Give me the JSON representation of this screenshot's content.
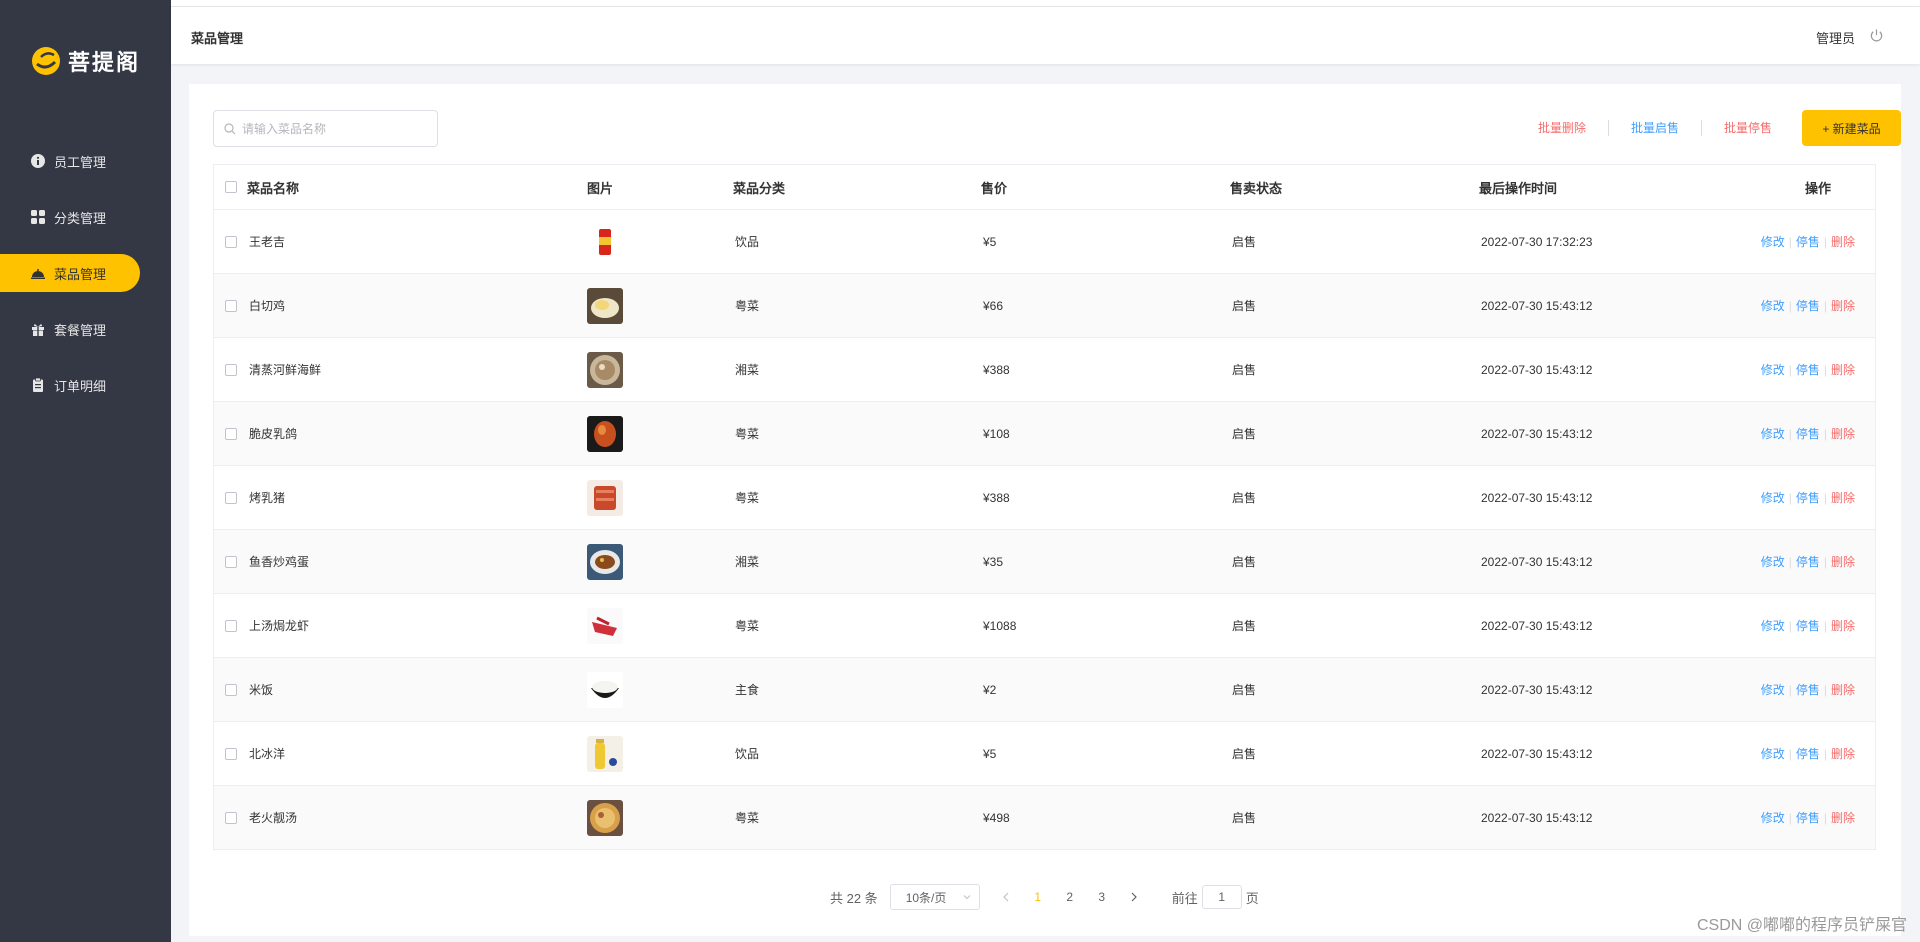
{
  "brand": {
    "name": "菩提阁",
    "accent": "#ffc200",
    "sidebar_bg": "#343744"
  },
  "sidebar": {
    "items": [
      {
        "label": "员工管理",
        "icon": "info-icon"
      },
      {
        "label": "分类管理",
        "icon": "grid-icon"
      },
      {
        "label": "菜品管理",
        "icon": "dish-cover-icon",
        "active": true
      },
      {
        "label": "套餐管理",
        "icon": "gift-icon"
      },
      {
        "label": "订单明细",
        "icon": "clipboard-icon"
      }
    ]
  },
  "header": {
    "title": "菜品管理",
    "user": "管理员"
  },
  "toolbar": {
    "search_placeholder": "请输入菜品名称",
    "batch_delete": "批量删除",
    "batch_enable": "批量启售",
    "batch_disable": "批量停售",
    "add_button": "+ 新建菜品"
  },
  "table": {
    "columns": [
      "菜品名称",
      "图片",
      "菜品分类",
      "售价",
      "售卖状态",
      "最后操作时间",
      "操作"
    ],
    "op_edit": "修改",
    "op_disable": "停售",
    "op_delete": "删除",
    "rows": [
      {
        "name": "王老吉",
        "category": "饮品",
        "price": "¥5",
        "status": "启售",
        "time": "2022-07-30 17:32:23"
      },
      {
        "name": "白切鸡",
        "category": "粤菜",
        "price": "¥66",
        "status": "启售",
        "time": "2022-07-30 15:43:12"
      },
      {
        "name": "清蒸河鲜海鲜",
        "category": "湘菜",
        "price": "¥388",
        "status": "启售",
        "time": "2022-07-30 15:43:12"
      },
      {
        "name": "脆皮乳鸽",
        "category": "粤菜",
        "price": "¥108",
        "status": "启售",
        "time": "2022-07-30 15:43:12"
      },
      {
        "name": "烤乳猪",
        "category": "粤菜",
        "price": "¥388",
        "status": "启售",
        "time": "2022-07-30 15:43:12"
      },
      {
        "name": "鱼香炒鸡蛋",
        "category": "湘菜",
        "price": "¥35",
        "status": "启售",
        "time": "2022-07-30 15:43:12"
      },
      {
        "name": "上汤焗龙虾",
        "category": "粤菜",
        "price": "¥1088",
        "status": "启售",
        "time": "2022-07-30 15:43:12"
      },
      {
        "name": "米饭",
        "category": "主食",
        "price": "¥2",
        "status": "启售",
        "time": "2022-07-30 15:43:12"
      },
      {
        "name": "北冰洋",
        "category": "饮品",
        "price": "¥5",
        "status": "启售",
        "time": "2022-07-30 15:43:12"
      },
      {
        "name": "老火靓汤",
        "category": "粤菜",
        "price": "¥498",
        "status": "启售",
        "time": "2022-07-30 15:43:12"
      }
    ]
  },
  "pagination": {
    "total": "共 22 条",
    "page_size": "10条/页",
    "pages": [
      "1",
      "2",
      "3"
    ],
    "current": "1",
    "goto_prefix": "前往",
    "goto_value": "1",
    "goto_suffix": "页"
  },
  "watermark": "CSDN @嘟嘟的程序员铲屎官"
}
